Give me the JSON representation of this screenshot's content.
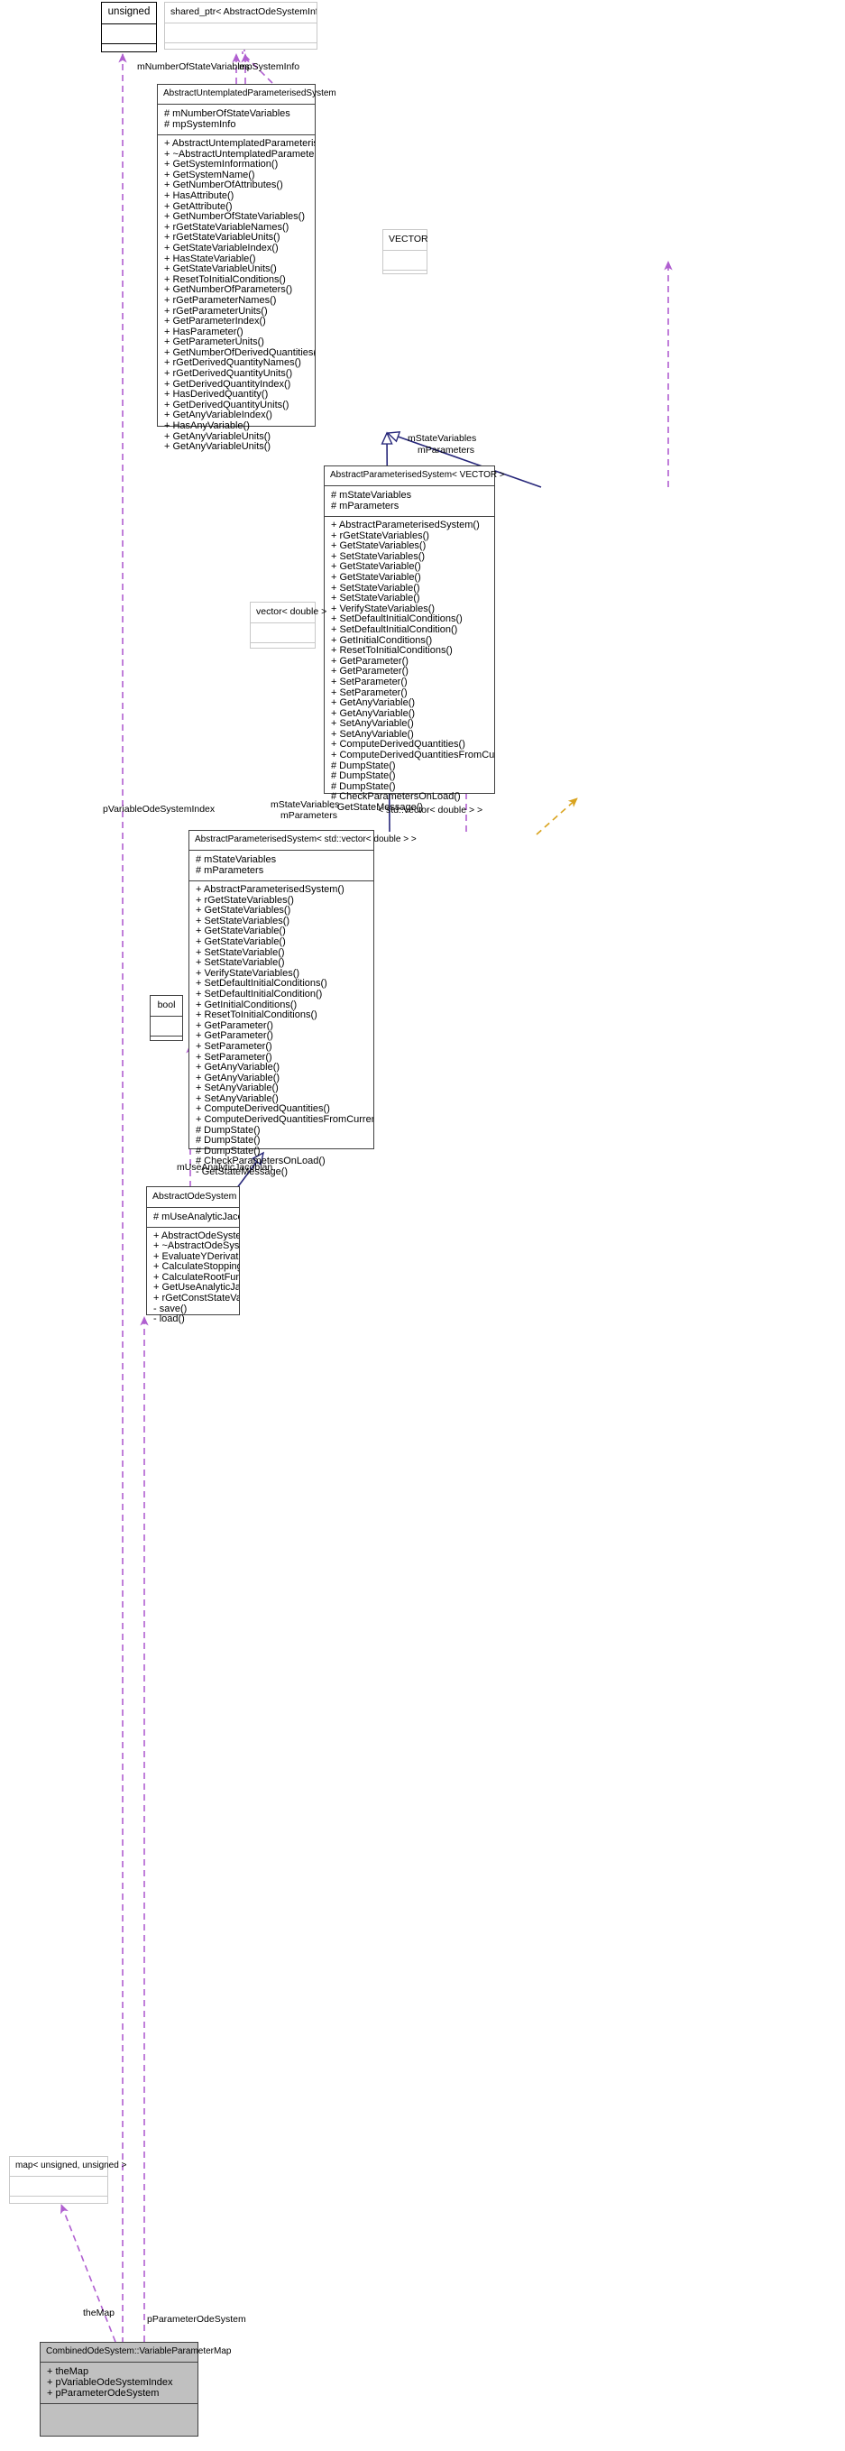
{
  "diagram": {
    "kind": "uml-class-collaboration-diagram",
    "colors": {
      "inheritance_edge": "#27277a",
      "usage_edge": "#b05fd0",
      "template_edge": "#d9a31e",
      "node_border": "#404040",
      "node_border_thick": "#000000",
      "node_border_faint": "#c8c8c8",
      "highlight_fill": "#c0c0c0"
    }
  },
  "nodes": {
    "unsigned": {
      "title": "unsigned",
      "attributes": [],
      "operations": []
    },
    "shared_ptr": {
      "title": "shared_ptr< AbstractOdeSystemInformation >",
      "attributes": [],
      "operations": []
    },
    "abstract_untemplated": {
      "title": "AbstractUntemplatedParameterisedSystem",
      "attributes": [
        "# mNumberOfStateVariables",
        "# mpSystemInfo"
      ],
      "operations": [
        "+ AbstractUntemplatedParameterisedSystem()",
        "+ ~AbstractUntemplatedParameterisedSystem()",
        "+ GetSystemInformation()",
        "+ GetSystemName()",
        "+ GetNumberOfAttributes()",
        "+ HasAttribute()",
        "+ GetAttribute()",
        "+ GetNumberOfStateVariables()",
        "+ rGetStateVariableNames()",
        "+ rGetStateVariableUnits()",
        "+ GetStateVariableIndex()",
        "+ HasStateVariable()",
        "+ GetStateVariableUnits()",
        "+ ResetToInitialConditions()",
        "+ GetNumberOfParameters()",
        "+ rGetParameterNames()",
        "+ rGetParameterUnits()",
        "+ GetParameterIndex()",
        "+ HasParameter()",
        "+ GetParameterUnits()",
        "+ GetNumberOfDerivedQuantities()",
        "+ rGetDerivedQuantityNames()",
        "+ rGetDerivedQuantityUnits()",
        "+ GetDerivedQuantityIndex()",
        "+ HasDerivedQuantity()",
        "+ GetDerivedQuantityUnits()",
        "+ GetAnyVariableIndex()",
        "+ HasAnyVariable()",
        "+ GetAnyVariableUnits()",
        "+ GetAnyVariableUnits()"
      ]
    },
    "vector_template": {
      "title": "VECTOR",
      "attributes": [],
      "operations": []
    },
    "abstract_param_vector": {
      "title": "AbstractParameterisedSystem< VECTOR >",
      "attributes": [
        "# mStateVariables",
        "# mParameters"
      ],
      "operations": [
        "+ AbstractParameterisedSystem()",
        "+ rGetStateVariables()",
        "+ GetStateVariables()",
        "+ SetStateVariables()",
        "+ GetStateVariable()",
        "+ GetStateVariable()",
        "+ SetStateVariable()",
        "+ SetStateVariable()",
        "+ VerifyStateVariables()",
        "+ SetDefaultInitialConditions()",
        "+ SetDefaultInitialCondition()",
        "+ GetInitialConditions()",
        "+ ResetToInitialConditions()",
        "+ GetParameter()",
        "+ GetParameter()",
        "+ SetParameter()",
        "+ SetParameter()",
        "+ GetAnyVariable()",
        "+ GetAnyVariable()",
        "+ SetAnyVariable()",
        "+ SetAnyVariable()",
        "+ ComputeDerivedQuantities()",
        "+ ComputeDerivedQuantitiesFromCurrentState()",
        "# DumpState()",
        "# DumpState()",
        "# DumpState()",
        "# CheckParametersOnLoad()",
        "- GetStateMessage()"
      ]
    },
    "vector_double": {
      "title": "vector< double >",
      "attributes": [],
      "operations": []
    },
    "abstract_param_stdvector": {
      "title": "AbstractParameterisedSystem< std::vector< double > >",
      "attributes": [
        "# mStateVariables",
        "# mParameters"
      ],
      "operations": [
        "+ AbstractParameterisedSystem()",
        "+ rGetStateVariables()",
        "+ GetStateVariables()",
        "+ SetStateVariables()",
        "+ GetStateVariable()",
        "+ GetStateVariable()",
        "+ SetStateVariable()",
        "+ SetStateVariable()",
        "+ VerifyStateVariables()",
        "+ SetDefaultInitialConditions()",
        "+ SetDefaultInitialCondition()",
        "+ GetInitialConditions()",
        "+ ResetToInitialConditions()",
        "+ GetParameter()",
        "+ GetParameter()",
        "+ SetParameter()",
        "+ SetParameter()",
        "+ GetAnyVariable()",
        "+ GetAnyVariable()",
        "+ SetAnyVariable()",
        "+ SetAnyVariable()",
        "+ ComputeDerivedQuantities()",
        "+ ComputeDerivedQuantitiesFromCurrentState()",
        "# DumpState()",
        "# DumpState()",
        "# DumpState()",
        "# CheckParametersOnLoad()",
        "- GetStateMessage()"
      ]
    },
    "bool": {
      "title": "bool",
      "attributes": [],
      "operations": []
    },
    "abstract_ode_system": {
      "title": "AbstractOdeSystem",
      "attributes": [
        "# mUseAnalyticJacobian"
      ],
      "operations": [
        "+ AbstractOdeSystem()",
        "+ ~AbstractOdeSystem()",
        "+ EvaluateYDerivatives()",
        "+ CalculateStoppingEvent()",
        "+ CalculateRootFunction()",
        "+ GetUseAnalyticJacobian()",
        "+ rGetConstStateVariables()",
        "- save()",
        "- load()"
      ]
    },
    "map_unsigned": {
      "title": "map< unsigned, unsigned >",
      "attributes": [],
      "operations": []
    },
    "combined_ode_system_map": {
      "title": "CombinedOdeSystem::VariableParameterMap",
      "attributes": [
        "+ theMap",
        "+ pVariableOdeSystemIndex",
        "+ pParameterOdeSystem"
      ],
      "operations": []
    }
  },
  "edge_labels": {
    "mNumberOfStateVariables": "mNumberOfStateVariables",
    "mpSystemInfo": "mpSystemInfo",
    "mStateVariables_vector": "mStateVariables",
    "mParameters_vector": "mParameters",
    "mStateVariables_std": "mStateVariables",
    "mParameters_std": "mParameters",
    "template_arg": "< std::vector< double > >",
    "pVariableOdeSystemIndex": "pVariableOdeSystemIndex",
    "mUseAnalyticJacobian": "mUseAnalyticJacobian",
    "theMap": "theMap",
    "pParameterOdeSystem": "pParameterOdeSystem"
  }
}
